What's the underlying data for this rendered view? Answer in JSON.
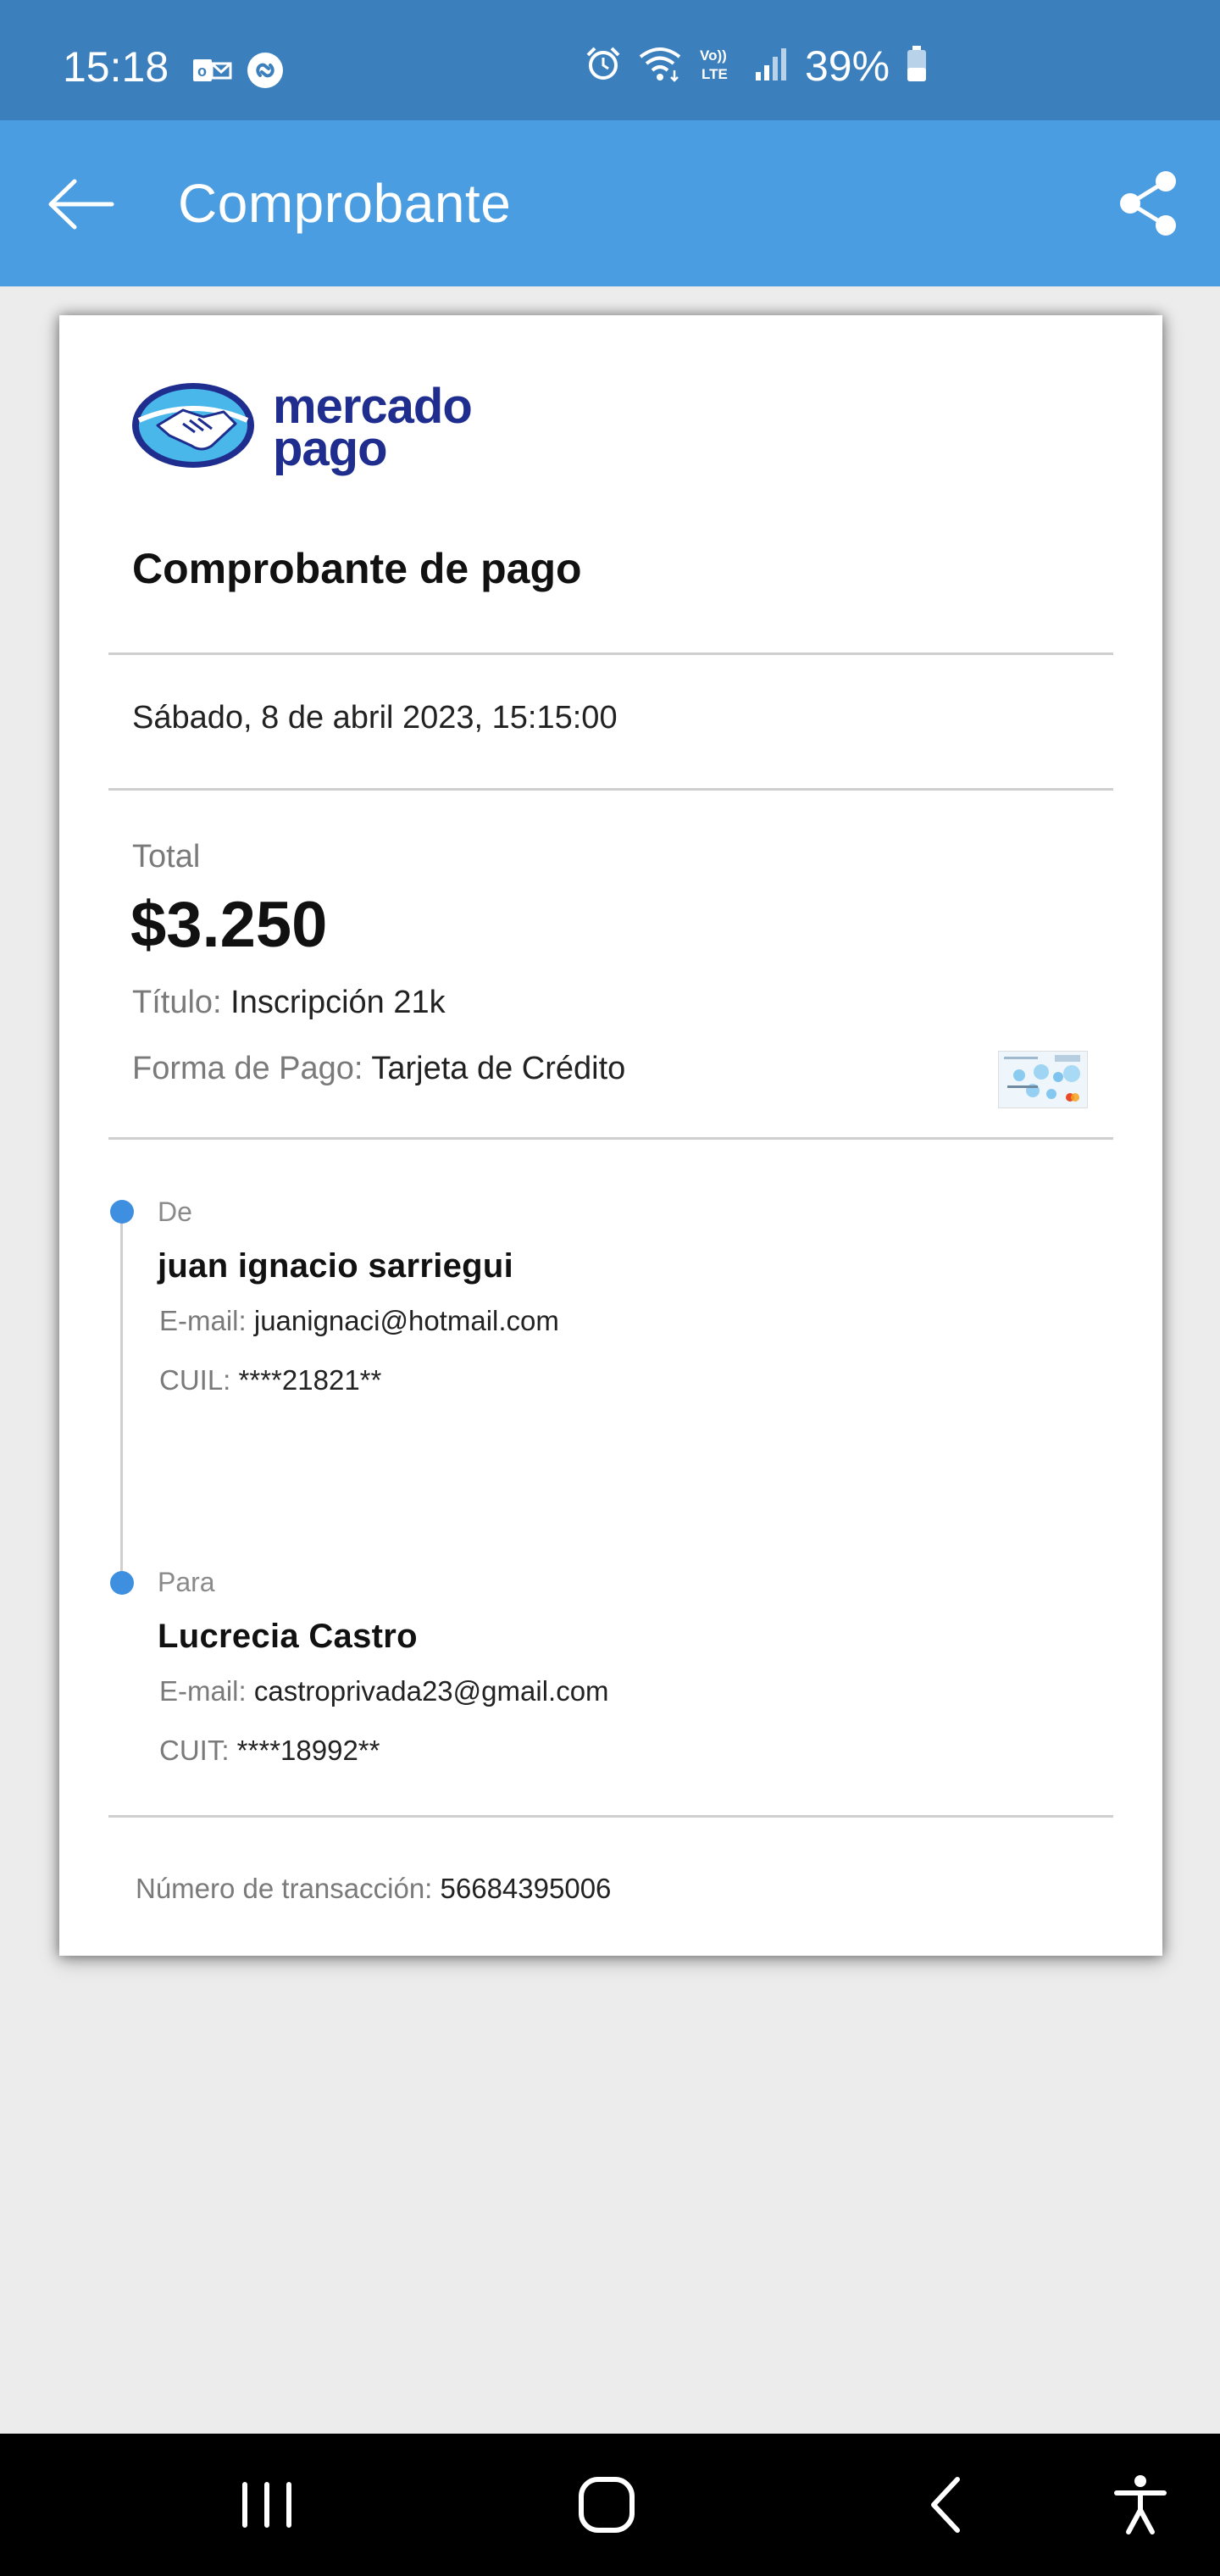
{
  "status_bar": {
    "time": "15:18",
    "battery_percent": "39%",
    "left_icons": [
      "outlook-icon",
      "shazam-icon"
    ],
    "right_icons": [
      "alarm-icon",
      "wifi-icon",
      "volte-icon",
      "signal-icon",
      "battery-icon"
    ]
  },
  "app_bar": {
    "title": "Comprobante",
    "back_icon": "arrow-left-icon",
    "share_icon": "share-icon",
    "background": "#4a9de0"
  },
  "receipt": {
    "logo_line1": "mercado",
    "logo_line2": "pago",
    "title": "Comprobante de pago",
    "date": "Sábado, 8 de abril 2023, 15:15:00",
    "total_label": "Total",
    "total_amount": "$3.250",
    "title_label": "Título:",
    "title_value": "Inscripción 21k",
    "payment_label": "Forma de Pago:",
    "payment_value": "Tarjeta de Crédito",
    "from": {
      "label": "De",
      "name": "juan ignacio sarriegui",
      "email_label": "E-mail:",
      "email": "juanignaci@hotmail.com",
      "id_label": "CUIL:",
      "id_value": "****21821**"
    },
    "to": {
      "label": "Para",
      "name": "Lucrecia Castro",
      "email_label": "E-mail:",
      "email": "castroprivada23@gmail.com",
      "id_label": "CUIT:",
      "id_value": "****18992**"
    },
    "transaction_label": "Número de transacción:",
    "transaction_number": "56684395006"
  },
  "nav_bar": {
    "buttons": [
      "recent-apps-icon",
      "home-icon",
      "back-icon",
      "accessibility-icon"
    ]
  },
  "colors": {
    "status_bar": "#3c7fbd",
    "accent": "#3f8fe0",
    "logo": "#1e2d8e"
  }
}
